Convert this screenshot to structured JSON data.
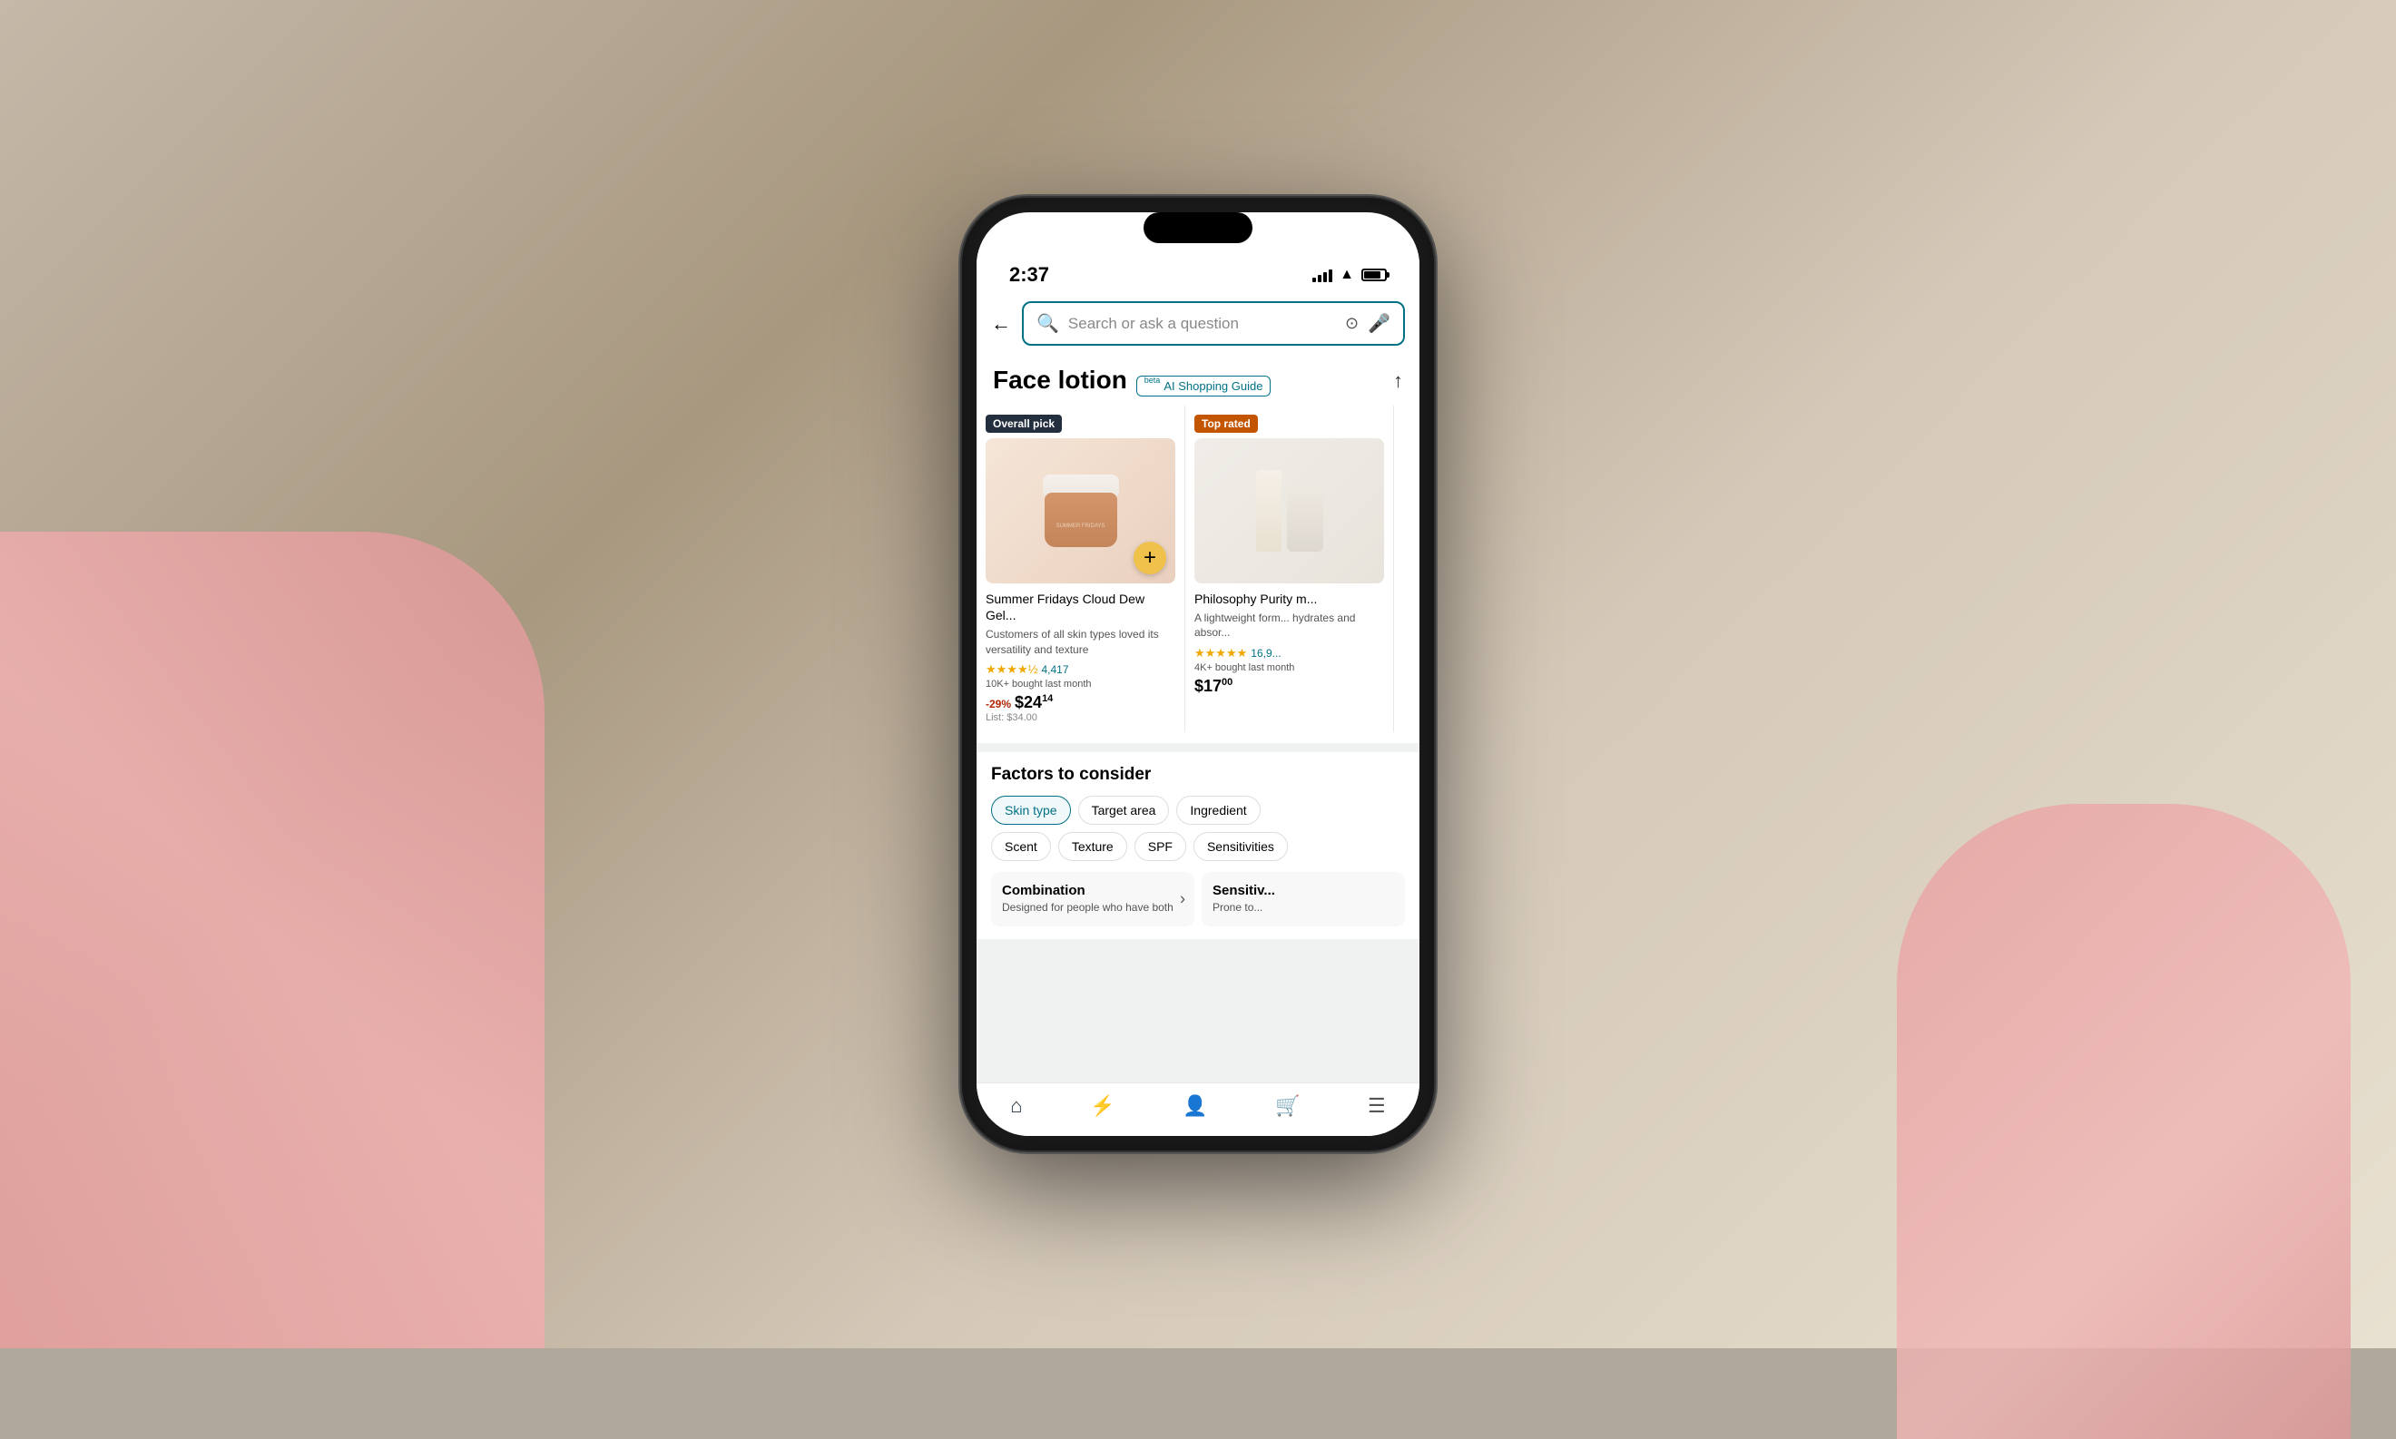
{
  "status": {
    "time": "2:37",
    "signal": "●●●",
    "wifi": "wifi",
    "battery": "battery"
  },
  "search": {
    "placeholder": "Search or ask a question"
  },
  "header": {
    "title": "Face lotion",
    "ai_guide": "AI Shopping Guide",
    "beta": "beta",
    "share_icon": "↑"
  },
  "products": [
    {
      "badge": "Overall pick",
      "badge_type": "overall",
      "name": "Summer Fridays Cloud Dew Gel...",
      "desc": "Customers of all skin types loved its versatility and texture",
      "stars": "★★★★½",
      "reviews": "4,417",
      "bought": "10K+ bought last month",
      "discount": "-29%",
      "price": "24",
      "cents": "14",
      "list": "List: $34.00"
    },
    {
      "badge": "Top rated",
      "badge_type": "top",
      "name": "Philosophy Purity m...",
      "desc": "A lightweight form... hydrates and absor...",
      "stars": "★★★★★",
      "reviews": "16,9...",
      "bought": "4K+ bought last month",
      "price": "17",
      "cents": "00",
      "list": ""
    }
  ],
  "factors": {
    "title": "Factors to consider",
    "chips": [
      {
        "label": "Skin type",
        "active": true
      },
      {
        "label": "Target area",
        "active": false
      },
      {
        "label": "Ingredient",
        "active": false
      },
      {
        "label": "Scent",
        "active": false
      },
      {
        "label": "Texture",
        "active": false
      },
      {
        "label": "SPF",
        "active": false
      },
      {
        "label": "Sensitivities",
        "active": false
      }
    ],
    "panel_left": {
      "title": "Combination",
      "desc": "Designed for people who have both",
      "arrow": "›"
    },
    "panel_right": {
      "title": "Sensitiv...",
      "desc": "Prone to..."
    }
  },
  "bottom_nav": [
    {
      "icon": "⌂",
      "label": "home",
      "active": true
    },
    {
      "icon": "⚡",
      "label": "activity",
      "active": false
    },
    {
      "icon": "👤",
      "label": "profile",
      "active": false
    },
    {
      "icon": "🛒",
      "label": "cart",
      "active": false
    },
    {
      "icon": "☰",
      "label": "menu",
      "active": false
    }
  ]
}
